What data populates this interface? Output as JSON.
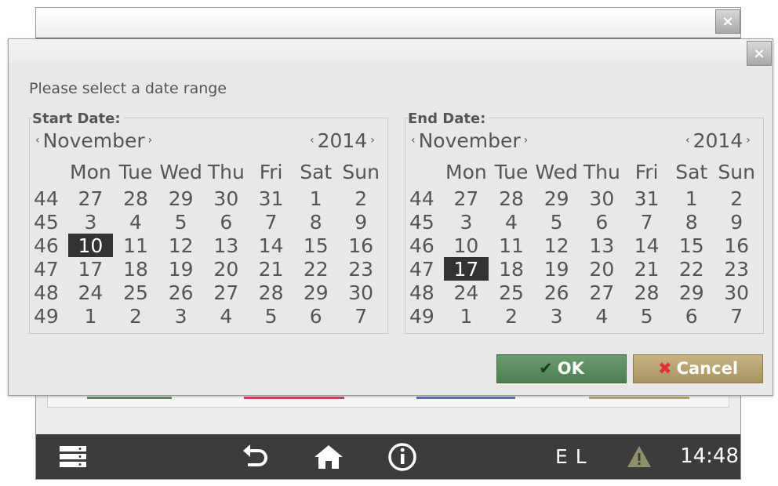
{
  "background_window": {
    "close_label": "×",
    "strip_colors": [
      "#5c8f5f",
      "#b8505a",
      "#5a74b3",
      "#b8a570"
    ]
  },
  "taskbar": {
    "icons": [
      "menu-icon",
      "back-icon",
      "home-icon",
      "info-icon",
      "warning-icon"
    ],
    "status_text": "E L",
    "time": "14:48"
  },
  "dialog": {
    "close_label": "×",
    "prompt": "Please select a date range",
    "start": {
      "label": "Start Date:",
      "month": "November",
      "year": "2014",
      "selected_day": "10",
      "prev_arrow": "‹",
      "next_arrow": "›"
    },
    "end": {
      "label": "End Date:",
      "month": "November",
      "year": "2014",
      "selected_day": "17",
      "prev_arrow": "‹",
      "next_arrow": "›"
    },
    "weekday_headers": [
      "Mon",
      "Tue",
      "Wed",
      "Thu",
      "Fri",
      "Sat",
      "Sun"
    ],
    "weeks": [
      {
        "week": "44",
        "days": [
          "27",
          "28",
          "29",
          "30",
          "31",
          "1",
          "2"
        ]
      },
      {
        "week": "45",
        "days": [
          "3",
          "4",
          "5",
          "6",
          "7",
          "8",
          "9"
        ]
      },
      {
        "week": "46",
        "days": [
          "10",
          "11",
          "12",
          "13",
          "14",
          "15",
          "16"
        ]
      },
      {
        "week": "47",
        "days": [
          "17",
          "18",
          "19",
          "20",
          "21",
          "22",
          "23"
        ]
      },
      {
        "week": "48",
        "days": [
          "24",
          "25",
          "26",
          "27",
          "28",
          "29",
          "30"
        ]
      },
      {
        "week": "49",
        "days": [
          "1",
          "2",
          "3",
          "4",
          "5",
          "6",
          "7"
        ]
      }
    ],
    "ok_label": "OK",
    "ok_glyph": "✔",
    "cancel_label": "Cancel",
    "cancel_glyph": "✖",
    "colors": {
      "selected_bg": "#333333",
      "ok_green": "#4b7f50",
      "cancel_gold": "#a8935f",
      "cancel_glyph": "#e03030"
    }
  }
}
